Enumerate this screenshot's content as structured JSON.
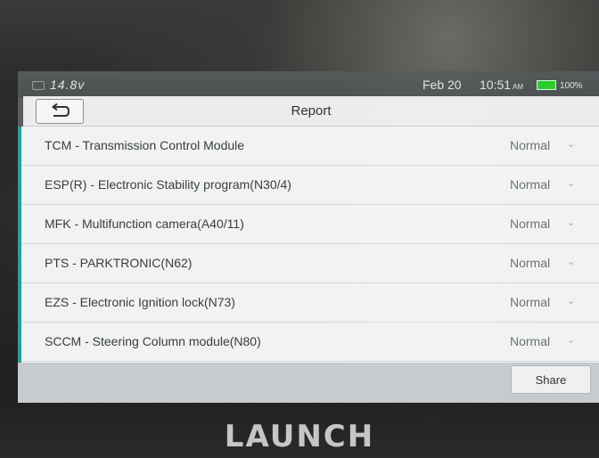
{
  "status_bar": {
    "voltage": "14.8v",
    "date": "Feb 20",
    "time": "10:51",
    "ampm": "AM",
    "battery": "100%",
    "battery_color": "#2ecc2e"
  },
  "header": {
    "back_icon": "back-arrow-icon",
    "title": "Report"
  },
  "report": {
    "rows": [
      {
        "label": "TCM - Transmission Control Module",
        "status": "Normal"
      },
      {
        "label": "ESP(R) - Electronic Stability program(N30/4)",
        "status": "Normal"
      },
      {
        "label": "MFK - Multifunction camera(A40/11)",
        "status": "Normal"
      },
      {
        "label": "PTS - PARKTRONIC(N62)",
        "status": "Normal"
      },
      {
        "label": "EZS - Electronic Ignition lock(N73)",
        "status": "Normal"
      },
      {
        "label": "SCCM - Steering Column module(N80)",
        "status": "Normal"
      }
    ]
  },
  "footer": {
    "share_label": "Share"
  },
  "device": {
    "brand": "LAUNCH"
  },
  "colors": {
    "accent": "#2f9c9a"
  }
}
